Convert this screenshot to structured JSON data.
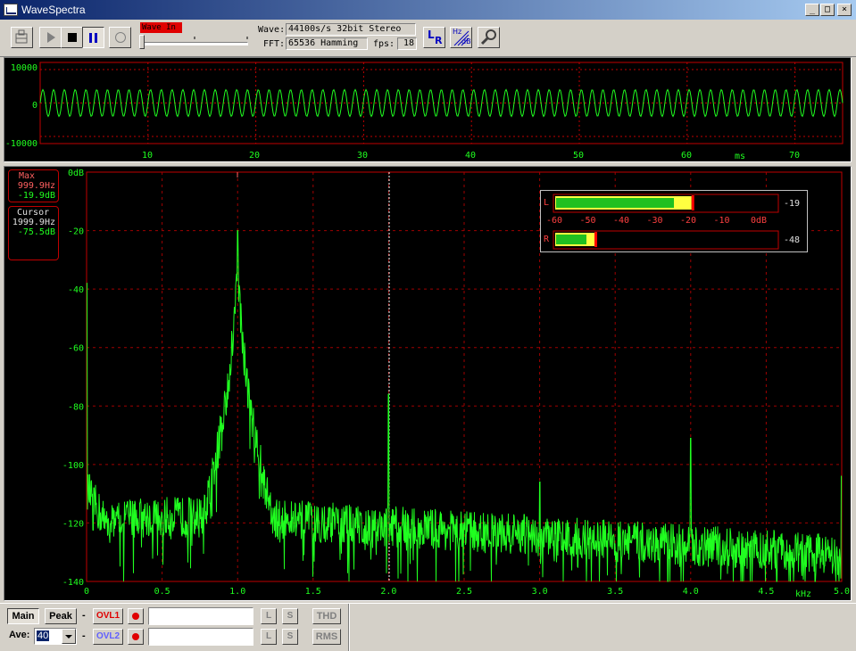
{
  "window": {
    "title": "WaveSpectra",
    "minimize": "_",
    "maximize": "□",
    "close": "×"
  },
  "toolbar": {
    "wave_in_label": "Wave In",
    "wave_label": "Wave:",
    "wave_format": "44100s/s 32bit Stereo",
    "fft_label": "FFT:",
    "fft_setting": "65536 Hamming",
    "fps_label": "fps:",
    "fps_value": "18",
    "lr_top": "L",
    "lr_bottom": "R",
    "hz_label": "Hz",
    "db_label": "dB"
  },
  "waveform": {
    "y_ticks": [
      "10000",
      "0",
      "-10000"
    ],
    "x_ticks": [
      "10",
      "20",
      "30",
      "40",
      "50",
      "60",
      "70"
    ],
    "x_unit": "ms",
    "color": "#20ff20"
  },
  "spectrum": {
    "y_ticks": [
      "0dB",
      "-20",
      "-40",
      "-60",
      "-80",
      "-100",
      "-120",
      "-140"
    ],
    "x_ticks": [
      "0",
      "0.5",
      "1.0",
      "1.5",
      "2.0",
      "2.5",
      "3.0",
      "3.5",
      "4.0",
      "4.5",
      "5.0"
    ],
    "x_unit": "kHz",
    "color": "#20ff20",
    "max_readout": {
      "title": "Max",
      "freq": "999.9Hz",
      "level": "-19.9dB"
    },
    "cursor_readout": {
      "title": "Cursor",
      "freq": "1999.9Hz",
      "level": "-75.5dB"
    }
  },
  "chart_data": {
    "type": "line",
    "xlabel": "kHz",
    "ylabel": "dB",
    "xlim": [
      0,
      5.0
    ],
    "ylim": [
      -140,
      0
    ],
    "grid": true,
    "series": [
      {
        "x": [
          0,
          0.1,
          0.3,
          0.5,
          0.7,
          0.9,
          0.95,
          0.98,
          1.0,
          1.02,
          1.05,
          1.1,
          1.3,
          1.5,
          1.99,
          2.0,
          2.01,
          2.5,
          2.99,
          3.0,
          3.01,
          3.5,
          3.99,
          4.0,
          4.01,
          4.5,
          4.99,
          5.0
        ],
        "y": [
          -38,
          -108,
          -118,
          -120,
          -118,
          -110,
          -100,
          -90,
          -20,
          -90,
          -100,
          -110,
          -118,
          -120,
          -124,
          -76,
          -124,
          -126,
          -128,
          -106,
          -128,
          -130,
          -130,
          -91,
          -130,
          -132,
          -132,
          -104
        ]
      }
    ]
  },
  "meter": {
    "left_label": "L",
    "right_label": "R",
    "left_value": "-19",
    "right_value": "-48",
    "scale": [
      "-60",
      "-50",
      "-40",
      "-30",
      "-20",
      "-10",
      "0dB"
    ],
    "left_level_db": -19,
    "right_level_db": -48
  },
  "bottom": {
    "main_label": "Main",
    "peak_label": "Peak",
    "ovl1_label": "OVL1",
    "ovl2_label": "OVL2",
    "ave_label": "Ave:",
    "ave_value": "40",
    "l_label": "L",
    "s_label": "S",
    "thd_label": "THD",
    "rms_label": "RMS"
  }
}
